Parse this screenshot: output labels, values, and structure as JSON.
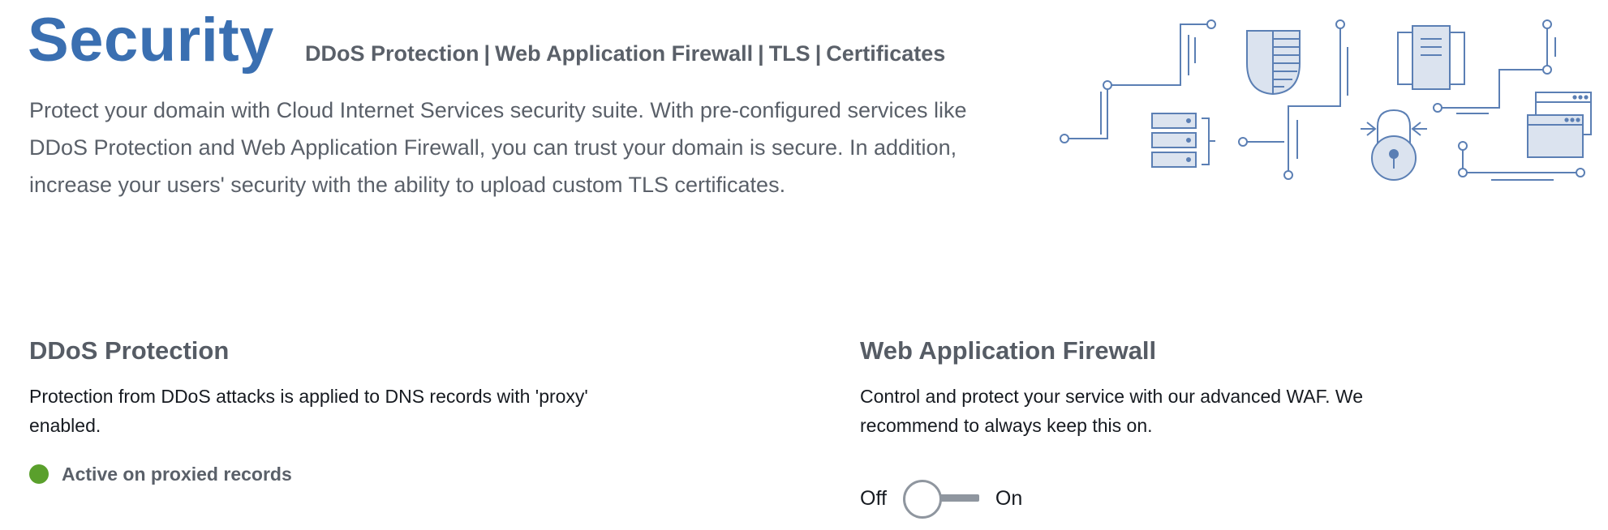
{
  "header": {
    "title": "Security",
    "subnav": [
      "DDoS Protection",
      "Web Application Firewall",
      "TLS",
      "Certificates"
    ],
    "separator": "|",
    "intro": "Protect your domain with Cloud Internet Services security suite. With pre-configured services like DDoS Protection and Web Application Firewall, you can trust your domain is secure. In addition, increase your users' security with the ability to upload custom TLS certificates."
  },
  "illustration": {
    "icons": [
      "server-stack-icon",
      "shield-icon",
      "document-icon",
      "padlock-icon",
      "browser-window-icon",
      "circuit-lines"
    ],
    "colors": {
      "stroke": "#5b7fb4",
      "fill": "#dbe3ef"
    }
  },
  "ddos": {
    "title": "DDoS Protection",
    "description": "Protection from DDoS attacks is applied to DNS records with 'proxy' enabled.",
    "status_label": "Active on proxied records",
    "status_color": "#5aa02c"
  },
  "waf": {
    "title": "Web Application Firewall",
    "description": "Control and protect your service with our advanced WAF. We recommend to always keep this on.",
    "toggle": {
      "off_label": "Off",
      "on_label": "On",
      "state": "off"
    }
  },
  "theme": {
    "accent": "#3a6fb1",
    "text": "#5a6069"
  }
}
